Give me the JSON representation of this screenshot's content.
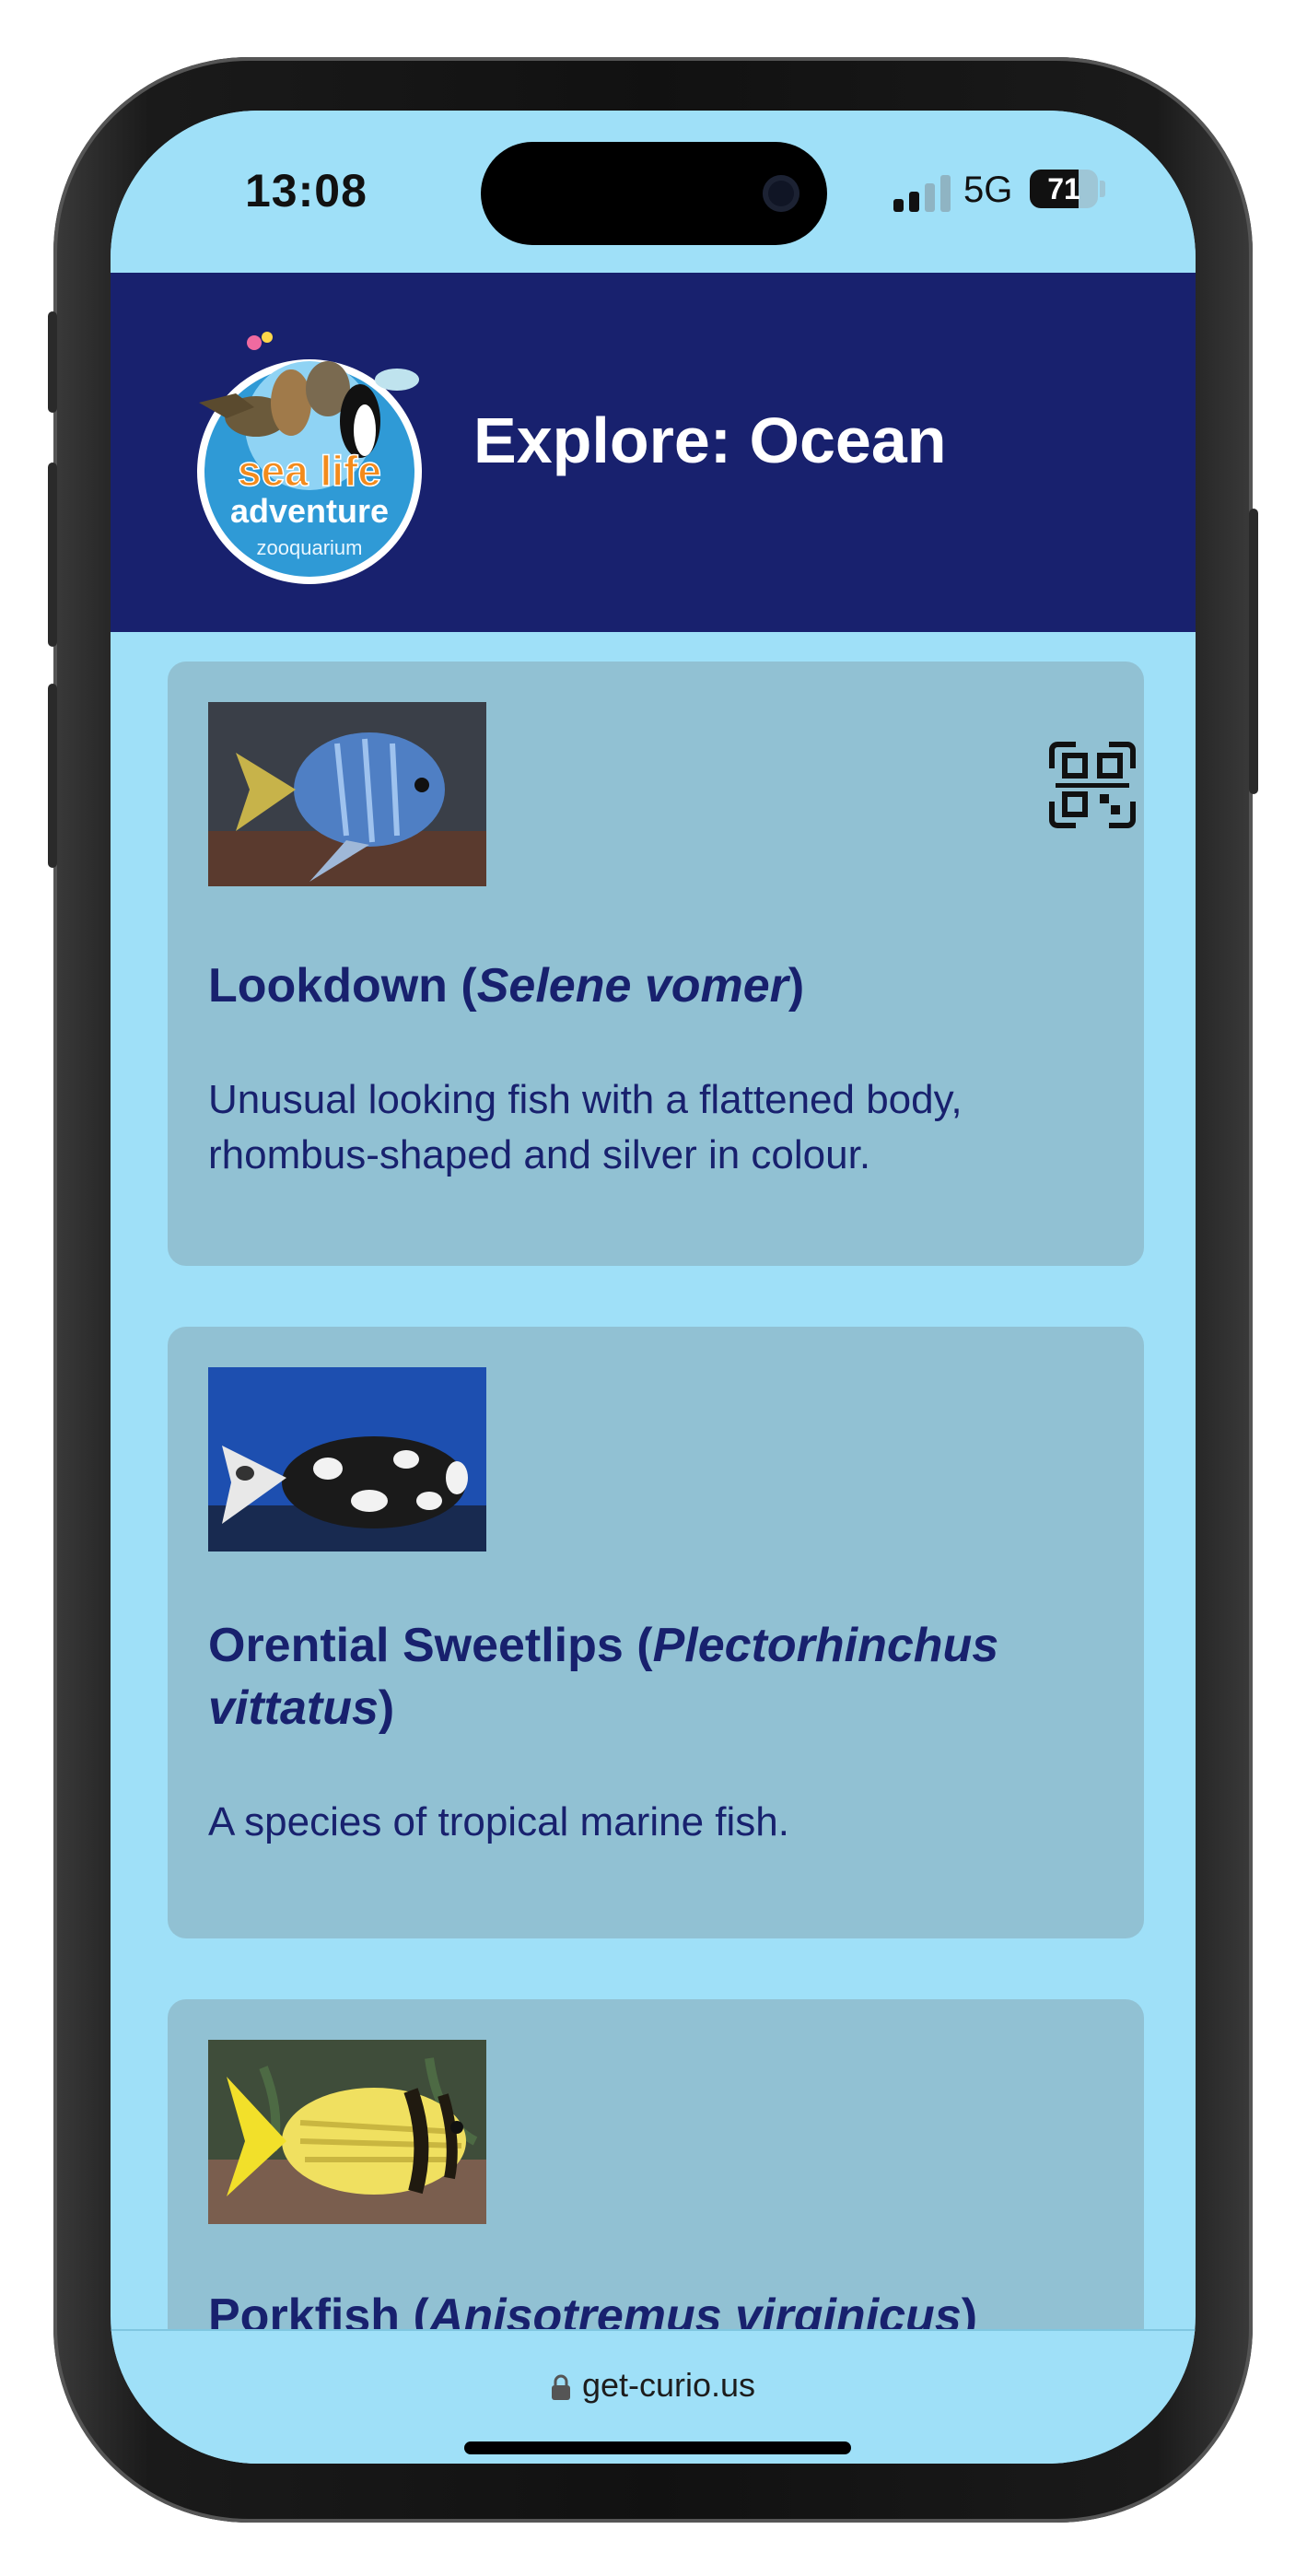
{
  "status": {
    "time": "13:08",
    "network": "5G",
    "battery": "71"
  },
  "header": {
    "title": "Explore: Ocean",
    "logo_text": [
      "sea life",
      "adventure",
      "zooquarium"
    ]
  },
  "cards": [
    {
      "name": "Lookdown (",
      "sci": "Selene vomer",
      "close": ")",
      "description": "Unusual looking fish with a flattened body, rhombus-shaped and silver in colour."
    },
    {
      "name": "Orential Sweetlips (",
      "sci": "Plectorhinchus vittatus",
      "close": ")",
      "description": "A species of tropical marine fish."
    },
    {
      "name": "Porkfish (",
      "sci": "Anisotremus virginicus",
      "close": ")",
      "description": ""
    }
  ],
  "browser": {
    "url": "get-curio.us"
  },
  "icons": {
    "qr": "qr-code-icon",
    "lock": "lock-icon"
  },
  "colors": {
    "header_bg": "#18216e",
    "page_bg": "#9fe0f8",
    "card_bg": "#91c1d3",
    "text": "#18216e"
  }
}
